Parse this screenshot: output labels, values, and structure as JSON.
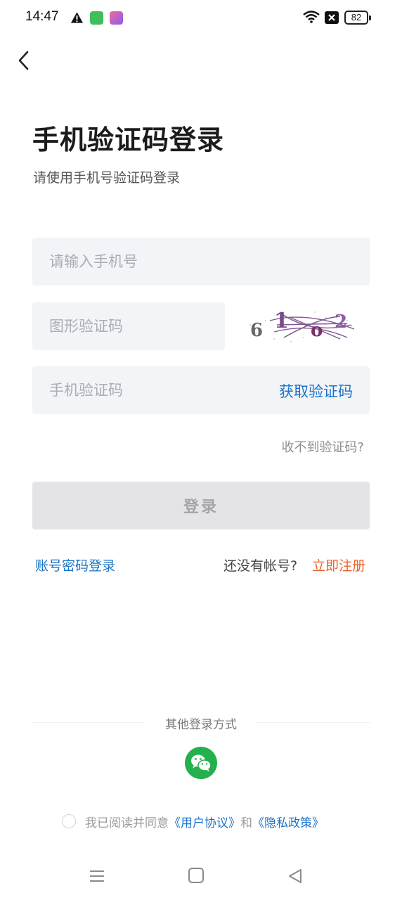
{
  "status_bar": {
    "time": "14:47",
    "battery": "82",
    "icons": [
      "alert-icon",
      "app-icon-green",
      "app-icon-purple",
      "wifi-icon",
      "sim-off-icon",
      "battery-icon"
    ]
  },
  "header": {
    "back_icon": "chevron-left-icon",
    "title": "手机验证码登录",
    "subtitle": "请使用手机号验证码登录"
  },
  "form": {
    "phone_placeholder": "请输入手机号",
    "captcha_placeholder": "图形验证码",
    "sms_placeholder": "手机验证码",
    "get_code_label": "获取验证码",
    "captcha_text": "6 1 0 2",
    "no_code_label": "收不到验证码?",
    "login_label": "登录"
  },
  "links": {
    "password_login": "账号密码登录",
    "no_account": "还没有帐号?",
    "register": "立即注册"
  },
  "other_login": {
    "label": "其他登录方式",
    "wechat_icon": "wechat-icon"
  },
  "agreement": {
    "prefix": "我已阅读并同意",
    "user_agreement": "《用户协议》",
    "and": "和",
    "privacy_policy": "《隐私政策》"
  },
  "nav": {
    "icons": [
      "menu-icon",
      "home-icon",
      "back-triangle-icon"
    ]
  },
  "colors": {
    "accent_blue": "#1a73c8",
    "register_orange": "#e9632e",
    "wechat_green": "#22b14c",
    "field_bg": "#f3f4f8",
    "button_disabled_bg": "#e4e4e6"
  }
}
